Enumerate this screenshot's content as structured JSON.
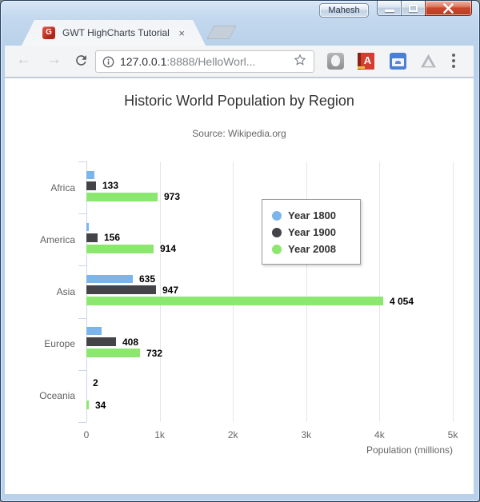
{
  "window": {
    "user_button_label": "Mahesh",
    "controls": [
      "minimize",
      "maximize",
      "close"
    ]
  },
  "browser": {
    "tab": {
      "title": "GWT HighCharts Tutorial",
      "close_glyph": "×",
      "favicon_letter": "G"
    },
    "toolbar": {
      "back_icon": "←",
      "forward_icon": "→",
      "url_host": "127.0.0.1",
      "url_rest": ":8888/HelloWorl...",
      "acrobat_letter": "A"
    },
    "extensions": [
      "shield-extension",
      "acrobat-extension",
      "screenshot-extension",
      "drive-extension"
    ]
  },
  "chart_data": {
    "type": "bar",
    "orientation": "horizontal",
    "title": "Historic World Population by Region",
    "subtitle": "Source: Wikipedia.org",
    "categories": [
      "Africa",
      "America",
      "Asia",
      "Europe",
      "Oceania"
    ],
    "series": [
      {
        "name": "Year 1800",
        "color": "#7cb5ec",
        "values": [
          107,
          31,
          635,
          203,
          2
        ],
        "labels": [
          "",
          "",
          "635",
          "",
          "2"
        ]
      },
      {
        "name": "Year 1900",
        "color": "#434348",
        "values": [
          133,
          156,
          947,
          408,
          6
        ],
        "labels": [
          "133",
          "156",
          "947",
          "408",
          ""
        ]
      },
      {
        "name": "Year 2008",
        "color": "#8ce76f",
        "values": [
          973,
          914,
          4054,
          732,
          34
        ],
        "labels": [
          "973",
          "914",
          "4 054",
          "732",
          "34"
        ]
      }
    ],
    "xlabel": "Population (millions)",
    "ylabel": "",
    "xlim": [
      0,
      5000
    ],
    "xticks": {
      "values": [
        0,
        1000,
        2000,
        3000,
        4000,
        5000
      ],
      "labels": [
        "0",
        "1k",
        "2k",
        "3k",
        "4k",
        "5k"
      ]
    },
    "legend": {
      "position": "inside-center",
      "entries": [
        "Year 1800",
        "Year 1900",
        "Year 2008"
      ]
    },
    "grid": "vertical-only"
  }
}
